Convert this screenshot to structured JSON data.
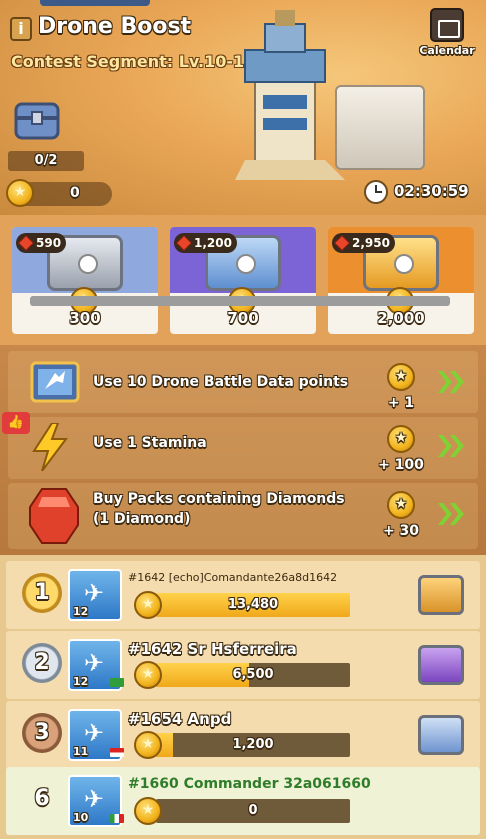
{
  "header": {
    "title": "Drone Boost",
    "subtitle": "Contest Segment: Lv.10-12",
    "calendar_label": "Calendar",
    "chest_progress": "0/2",
    "coin_balance": "0",
    "timer": "02:30:59"
  },
  "shop": {
    "items": [
      {
        "cost": "590",
        "price": "300",
        "color": "#8fa8de"
      },
      {
        "cost": "1,200",
        "price": "700",
        "color": "#7c63d6"
      },
      {
        "cost": "2,950",
        "price": "2,000",
        "color": "#ec8f2f"
      }
    ]
  },
  "tasks": [
    {
      "label": "Use 10 Drone Battle Data points",
      "reward": "+ 1"
    },
    {
      "label": "Use 1 Stamina",
      "reward": "+ 100"
    },
    {
      "label": "Buy Packs containing Diamonds (1 Diamond)",
      "reward": "+ 30"
    }
  ],
  "like_badge": "👍",
  "leaderboard": [
    {
      "rank": "1",
      "level": "12",
      "name": "#1642 [echo]Comandante26a8d1642",
      "score": "13,480",
      "fill": 1.0,
      "medal": "gold",
      "chest_color": "#f0b640"
    },
    {
      "rank": "2",
      "level": "12",
      "name": "#1642 Sr Hsferreira",
      "score": "6,500",
      "fill": 0.48,
      "medal": "silver",
      "chest_color": "#9b6bd8"
    },
    {
      "rank": "3",
      "level": "11",
      "name": "#1654 Anpd",
      "score": "1,200",
      "fill": 0.09,
      "medal": "bronze",
      "chest_color": "#7fa5dc"
    },
    {
      "rank": "6",
      "level": "10",
      "name": "#1660 Commander 32a061660",
      "score": "0",
      "fill": 0.0,
      "medal": "none",
      "chest_color": ""
    }
  ]
}
